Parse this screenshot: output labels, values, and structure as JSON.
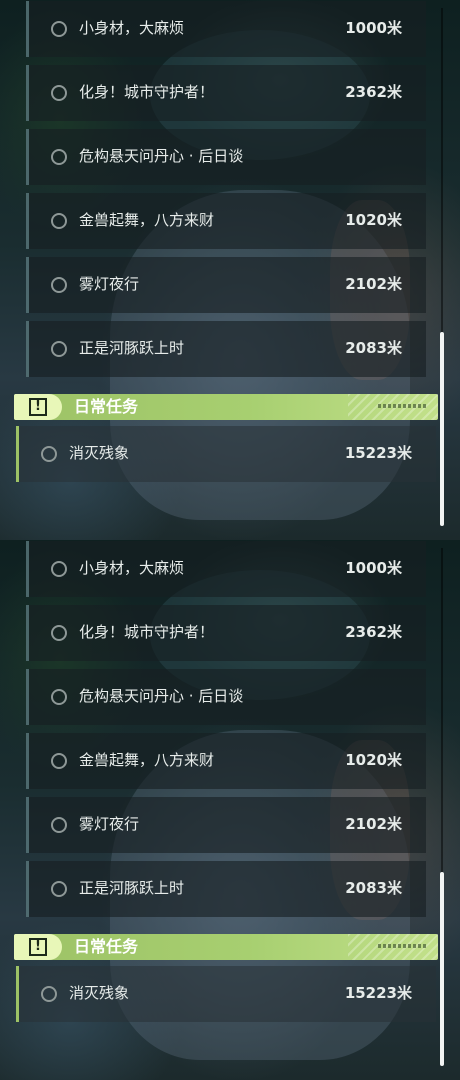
{
  "panels": [
    {
      "tasks": [
        {
          "name": "小身材，大麻烦",
          "distance": "1000米"
        },
        {
          "name": "化身！城市守护者！",
          "distance": "2362米"
        },
        {
          "name": "危构悬天问丹心 · 后日谈",
          "distance": ""
        },
        {
          "name": "金兽起舞，八方来财",
          "distance": "1020米"
        },
        {
          "name": "雾灯夜行",
          "distance": "2102米"
        },
        {
          "name": "正是河豚跃上时",
          "distance": "2083米"
        }
      ],
      "section": {
        "title": "日常任务",
        "icon": "exclamation-box-icon"
      },
      "daily": {
        "name": "消灭残象",
        "distance": "15223米"
      }
    },
    {
      "tasks": [
        {
          "name": "小身材，大麻烦",
          "distance": "1000米"
        },
        {
          "name": "化身！城市守护者！",
          "distance": "2362米"
        },
        {
          "name": "危构悬天问丹心 · 后日谈",
          "distance": ""
        },
        {
          "name": "金兽起舞，八方来财",
          "distance": "1020米"
        },
        {
          "name": "雾灯夜行",
          "distance": "2102米"
        },
        {
          "name": "正是河豚跃上时",
          "distance": "2083米"
        }
      ],
      "section": {
        "title": "日常任务",
        "icon": "exclamation-box-icon"
      },
      "daily": {
        "name": "消灭残象",
        "distance": "15223米"
      }
    }
  ],
  "badge_symbol": "!",
  "colors": {
    "accent": "#a7cf70",
    "badge": "#e8f7b8",
    "row_border": "#78a0a5"
  }
}
